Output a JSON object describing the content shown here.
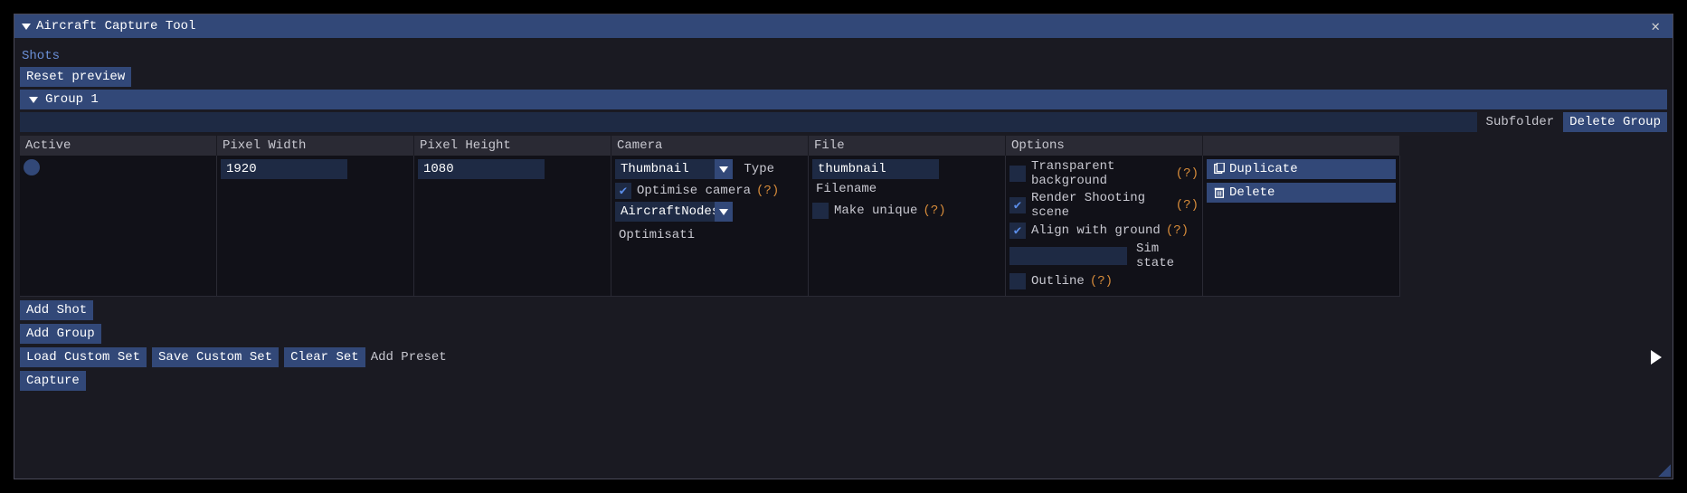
{
  "window": {
    "title": "Aircraft Capture Tool"
  },
  "section": {
    "shots": "Shots"
  },
  "buttons": {
    "reset_preview": "Reset preview",
    "delete_group": "Delete Group",
    "add_shot": "Add Shot",
    "add_group": "Add Group",
    "load_custom_set": "Load Custom Set",
    "save_custom_set": "Save Custom Set",
    "clear_set": "Clear Set",
    "add_preset": "Add Preset",
    "capture": "Capture",
    "duplicate": "Duplicate",
    "delete": "Delete"
  },
  "group": {
    "name": "Group 1",
    "subfolder_value": "",
    "subfolder_label": "Subfolder"
  },
  "columns": {
    "active": "Active",
    "pixel_width": "Pixel Width",
    "pixel_height": "Pixel Height",
    "camera": "Camera",
    "file": "File",
    "options": "Options"
  },
  "shot": {
    "pixel_width": "1920",
    "pixel_height": "1080",
    "camera_type_value": "Thumbnail",
    "camera_type_label": "Type",
    "camera_optim_value": "AircraftNodes",
    "camera_optim_label": "Optimisati",
    "optimise_camera": {
      "label": "Optimise camera",
      "help": "(?)",
      "checked": true
    },
    "file_name_value": "thumbnail",
    "file_name_label": "Filename",
    "make_unique": {
      "label": "Make unique",
      "help": "(?)",
      "checked": false
    },
    "options": {
      "transparent_bg": {
        "label": "Transparent background",
        "help": "(?)",
        "checked": false
      },
      "render_shoot": {
        "label": "Render Shooting scene",
        "help": "(?)",
        "checked": true
      },
      "align_ground": {
        "label": "Align with ground",
        "help": "(?)",
        "checked": true
      },
      "sim_state_value": "",
      "sim_state_label": "Sim state",
      "outline": {
        "label": "Outline",
        "help": "(?)",
        "checked": false
      }
    }
  }
}
